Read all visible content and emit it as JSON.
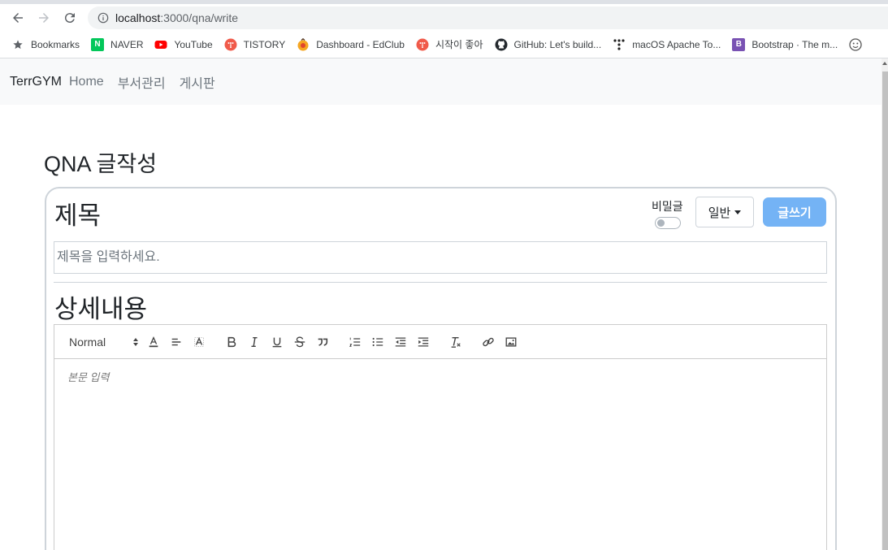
{
  "browser": {
    "url_host": "localhost",
    "url_path": ":3000/qna/write",
    "bookmarks": [
      {
        "label": "Bookmarks",
        "icon": "star-icon"
      },
      {
        "label": "NAVER",
        "icon": "naver-icon",
        "color": "#03c75a",
        "glyph": "N"
      },
      {
        "label": "YouTube",
        "icon": "youtube-icon",
        "color": "#ff0000"
      },
      {
        "label": "TISTORY",
        "icon": "tistory-icon",
        "color": "#f05a4a"
      },
      {
        "label": "Dashboard - EdClub",
        "icon": "edclub-icon",
        "color": "#f5a623"
      },
      {
        "label": "시작이 좋아",
        "icon": "tistory-icon",
        "color": "#f05a4a"
      },
      {
        "label": "GitHub: Let's build...",
        "icon": "github-icon",
        "color": "#24292e"
      },
      {
        "label": "macOS Apache To...",
        "icon": "dots-icon",
        "color": "#222222"
      },
      {
        "label": "Bootstrap · The m...",
        "icon": "bootstrap-icon",
        "color": "#7952b3",
        "glyph": "B"
      },
      {
        "label": "",
        "icon": "smiley-icon",
        "color": "#555555"
      }
    ]
  },
  "navbar": {
    "brand": "TerrGYM",
    "links": [
      "Home",
      "부서관리",
      "게시판"
    ]
  },
  "page": {
    "title": "QNA 글작성",
    "subject_label": "제목",
    "secret_label": "비밀글",
    "category_selected": "일반",
    "submit_label": "글쓰기",
    "title_placeholder": "제목을 입력하세요.",
    "content_label": "상세내용",
    "editor_header_value": "Normal",
    "editor_placeholder": "본문 입력"
  },
  "colors": {
    "submit": "#74b3f5",
    "navbar_bg": "#f8f9fa"
  }
}
